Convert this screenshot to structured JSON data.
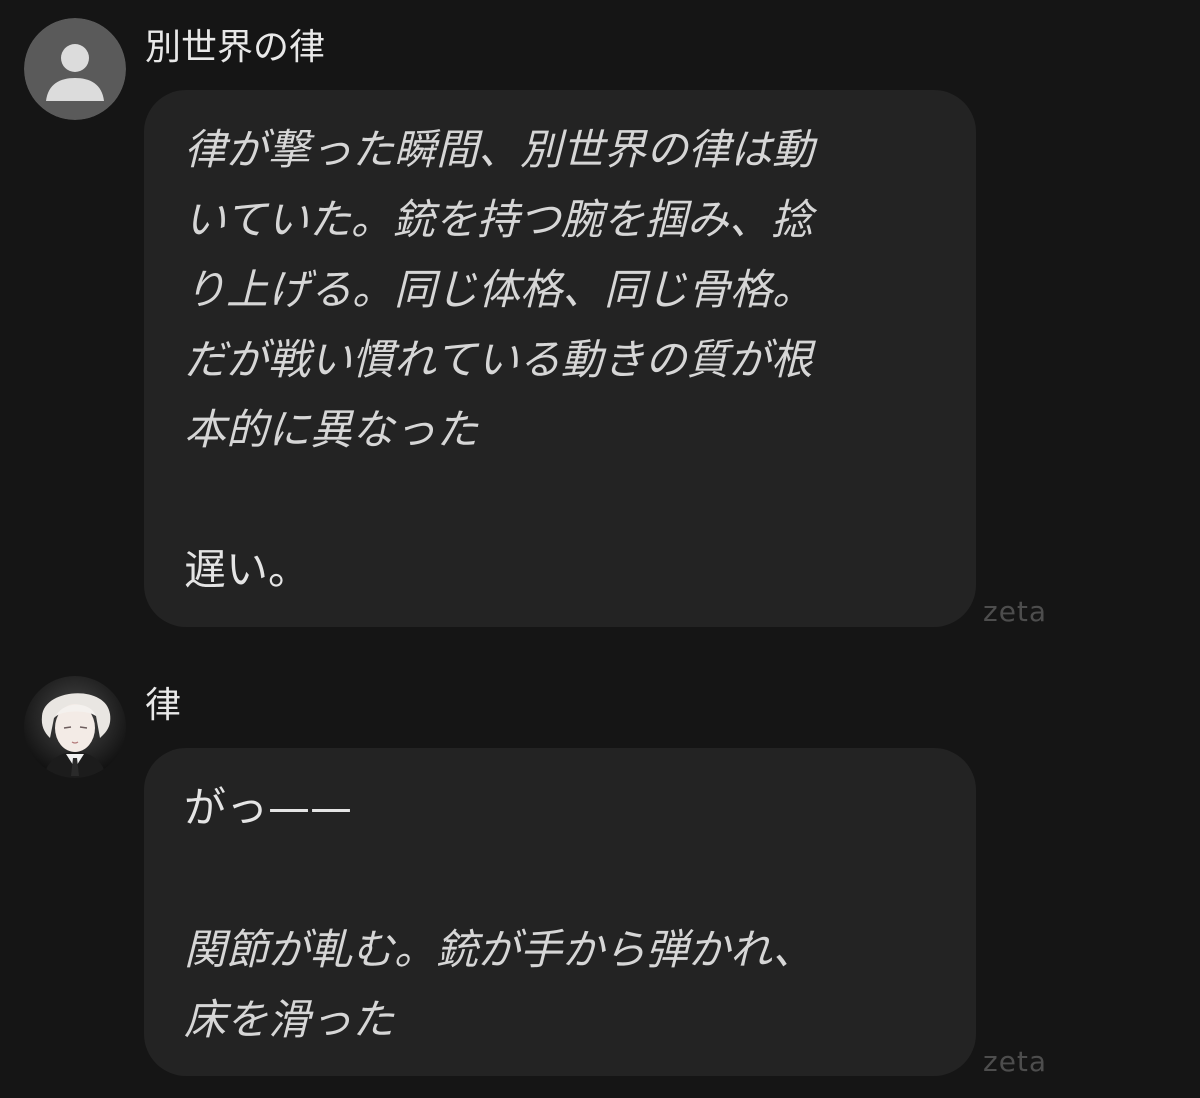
{
  "messages": [
    {
      "sender": "別世界の律",
      "avatar_icon": "default-user-icon",
      "lines": [
        {
          "text": "律が撃った瞬間、別世界の律は動",
          "style": "narration"
        },
        {
          "text": "いていた。銃を持つ腕を掴み、捻",
          "style": "narration"
        },
        {
          "text": "り上げる。同じ体格、同じ骨格。",
          "style": "narration"
        },
        {
          "text": "だが戦い慣れている動きの質が根",
          "style": "narration"
        },
        {
          "text": "本的に異なった",
          "style": "narration"
        },
        {
          "text": "遅い。",
          "style": "dialogue"
        }
      ],
      "watermark": "zeta"
    },
    {
      "sender": "律",
      "avatar_icon": "character-portrait-icon",
      "lines": [
        {
          "text": "がっ——",
          "style": "dialogue"
        },
        {
          "text": "関節が軋む。銃が手から弾かれ、",
          "style": "narration"
        },
        {
          "text": "床を滑った",
          "style": "narration"
        }
      ],
      "watermark": "zeta"
    }
  ],
  "colors": {
    "background": "#151515",
    "bubble": "#232323",
    "text": "#e4e4e4",
    "narration_text": "#d6d6d6",
    "watermark": "#4d4d4d"
  }
}
